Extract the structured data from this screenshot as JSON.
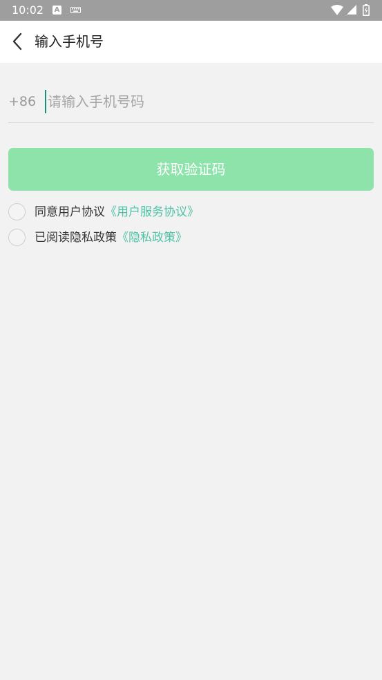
{
  "status_bar": {
    "time": "10:02",
    "indicator_letter": "A",
    "icons": [
      "keyboard-icon",
      "wifi-icon",
      "signal-icon",
      "battery-icon"
    ]
  },
  "app_bar": {
    "title": "输入手机号",
    "back_icon": "chevron-left-icon"
  },
  "phone": {
    "country_code": "+86",
    "value": "",
    "placeholder": "请输入手机号码"
  },
  "get_code_button": {
    "label": "获取验证码",
    "color": "#8de3aa"
  },
  "agreements": [
    {
      "text": "同意用户协议",
      "link": "《用户服务协议》",
      "checked": false
    },
    {
      "text": "已阅读隐私政策",
      "link": "《隐私政策》",
      "checked": false
    }
  ],
  "colors": {
    "accent": "#4fc3a5",
    "cursor": "#1a8f77",
    "background": "#f2f2f2"
  }
}
